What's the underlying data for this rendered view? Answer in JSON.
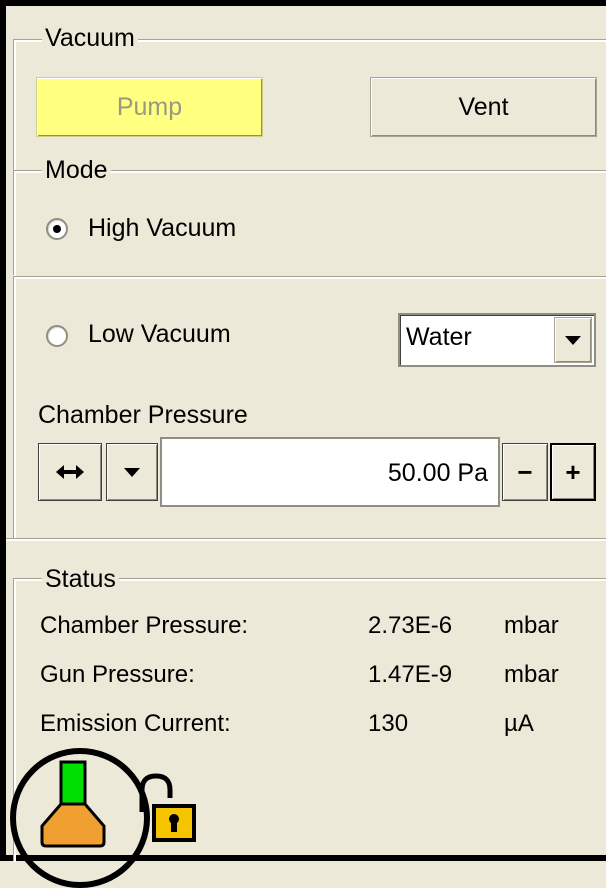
{
  "vacuum": {
    "group_label": "Vacuum",
    "pump_label": "Pump",
    "vent_label": "Vent"
  },
  "mode": {
    "group_label": "Mode",
    "high_vacuum_label": "High Vacuum",
    "high_vacuum_selected": true,
    "low_vacuum_label": "Low Vacuum",
    "low_vacuum_selected": false,
    "gas_selected": "Water"
  },
  "chamber_pressure_control": {
    "label": "Chamber Pressure",
    "value": "50.00 Pa",
    "minus_label": "−",
    "plus_label": "+"
  },
  "status": {
    "group_label": "Status",
    "rows": [
      {
        "label": "Chamber Pressure:",
        "value": "2.73E-6",
        "unit": "mbar"
      },
      {
        "label": "Gun Pressure:",
        "value": "1.47E-9",
        "unit": "mbar"
      },
      {
        "label": "Emission Current:",
        "value": "130",
        "unit": "µA"
      }
    ]
  },
  "icons": {
    "chamber_icon": "vacuum-chamber-icon",
    "lock_icon": "unlocked-padlock-icon",
    "colors": {
      "green": "#00e000",
      "orange": "#f0a030",
      "lock": "#f5c400"
    }
  }
}
